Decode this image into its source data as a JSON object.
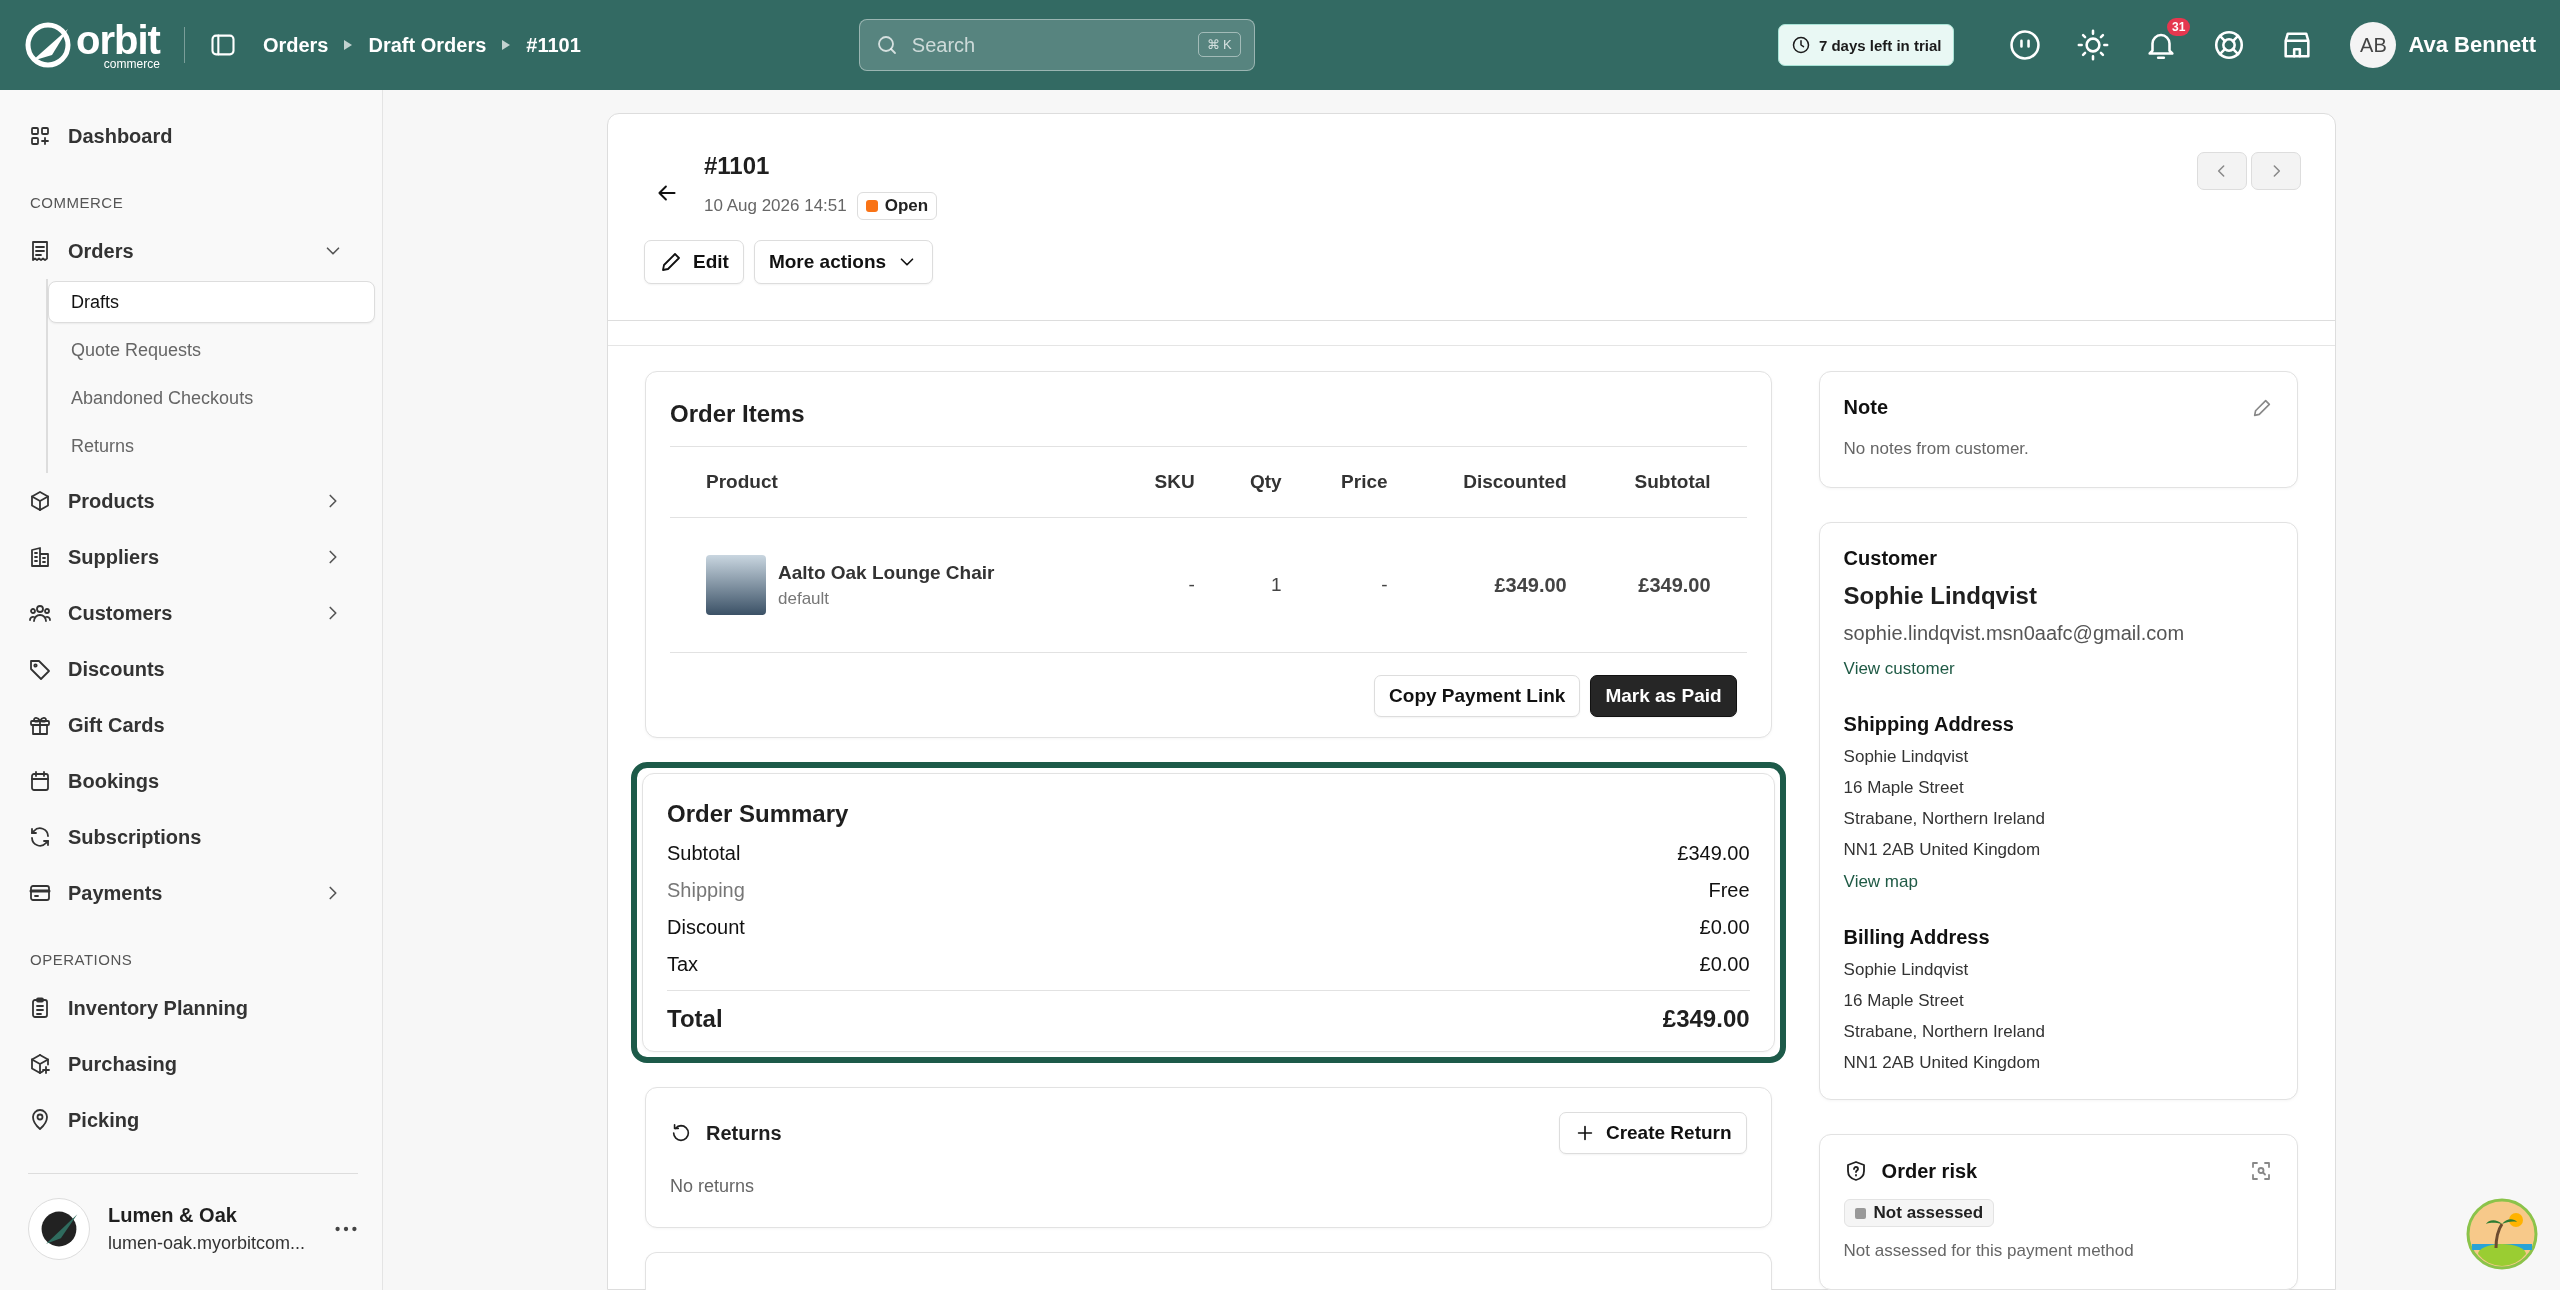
{
  "topbar": {
    "logo": {
      "name": "orbit",
      "sub": "commerce"
    },
    "breadcrumbs": [
      "Orders",
      "Draft Orders",
      "#1101"
    ],
    "search": {
      "placeholder": "Search",
      "shortcut": "⌘ K"
    },
    "trial": "7 days left in trial",
    "notifications": "31",
    "user": {
      "initials": "AB",
      "name": "Ava Bennett"
    }
  },
  "sidebar": {
    "sections": [
      {
        "items": [
          {
            "label": "Dashboard",
            "selected": false
          }
        ]
      },
      {
        "heading": "COMMERCE",
        "items": [
          {
            "label": "Orders",
            "selected": false,
            "expanded": true,
            "children": [
              {
                "label": "Drafts",
                "selected": true
              },
              {
                "label": "Quote Requests",
                "selected": false
              },
              {
                "label": "Abandoned Checkouts",
                "selected": false
              },
              {
                "label": "Returns",
                "selected": false
              }
            ]
          },
          {
            "label": "Products",
            "selected": false,
            "expanded": false
          },
          {
            "label": "Suppliers",
            "selected": false,
            "expanded": false
          },
          {
            "label": "Customers",
            "selected": false,
            "expanded": false
          },
          {
            "label": "Discounts",
            "selected": false
          },
          {
            "label": "Gift Cards",
            "selected": false
          },
          {
            "label": "Bookings",
            "selected": false
          },
          {
            "label": "Subscriptions",
            "selected": false
          },
          {
            "label": "Payments",
            "selected": false,
            "expanded": false
          }
        ]
      },
      {
        "heading": "OPERATIONS",
        "items": [
          {
            "label": "Inventory Planning",
            "selected": false
          },
          {
            "label": "Purchasing",
            "selected": false
          },
          {
            "label": "Picking",
            "selected": false
          }
        ]
      }
    ],
    "store": {
      "name": "Lumen & Oak",
      "domain": "lumen-oak.myorbitcom..."
    }
  },
  "order": {
    "title": "#1101",
    "date": "10 Aug 2026 14:51",
    "status": {
      "label": "Open",
      "color": "#f97316"
    },
    "actions": [
      "Edit",
      "More actions"
    ]
  },
  "items_card": {
    "title": "Order Items",
    "columns": [
      "Product",
      "SKU",
      "Qty",
      "Price",
      "Discounted",
      "Subtotal"
    ],
    "rows": [
      {
        "product": "Aalto Oak Lounge Chair",
        "variant": "default",
        "sku": "-",
        "qty": "1",
        "price": "-",
        "discounted": "£349.00",
        "subtotal": "£349.00"
      }
    ],
    "buttons": [
      {
        "label": "Copy Payment Link",
        "kind": "secondary"
      },
      {
        "label": "Mark as Paid",
        "kind": "primary"
      }
    ]
  },
  "summary": {
    "title": "Order Summary",
    "highlighted": true,
    "lines": [
      {
        "label": "Subtotal",
        "value": "£349.00",
        "muted": false
      },
      {
        "label": "Shipping",
        "value": "Free",
        "muted": true
      },
      {
        "label": "Discount",
        "value": "£0.00",
        "muted": false
      },
      {
        "label": "Tax",
        "value": "£0.00",
        "muted": false
      }
    ],
    "total": {
      "label": "Total",
      "value": "£349.00"
    }
  },
  "returns": {
    "title": "Returns",
    "button": "Create Return",
    "empty": "No returns"
  },
  "note": {
    "title": "Note",
    "text": "No notes from customer."
  },
  "customer": {
    "title": "Customer",
    "name": "Sophie Lindqvist",
    "email": "sophie.lindqvist.msn0aafc@gmail.com",
    "link": "View customer",
    "shipping": {
      "title": "Shipping Address",
      "lines": [
        "Sophie Lindqvist",
        "16 Maple Street",
        "Strabane, Northern Ireland",
        "NN1 2AB United Kingdom"
      ],
      "link": "View map"
    },
    "billing": {
      "title": "Billing Address",
      "lines": [
        "Sophie Lindqvist",
        "16 Maple Street",
        "Strabane, Northern Ireland",
        "NN1 2AB United Kingdom"
      ]
    }
  },
  "risk": {
    "title": "Order risk",
    "badge": "Not assessed",
    "text": "Not assessed for this payment method"
  }
}
